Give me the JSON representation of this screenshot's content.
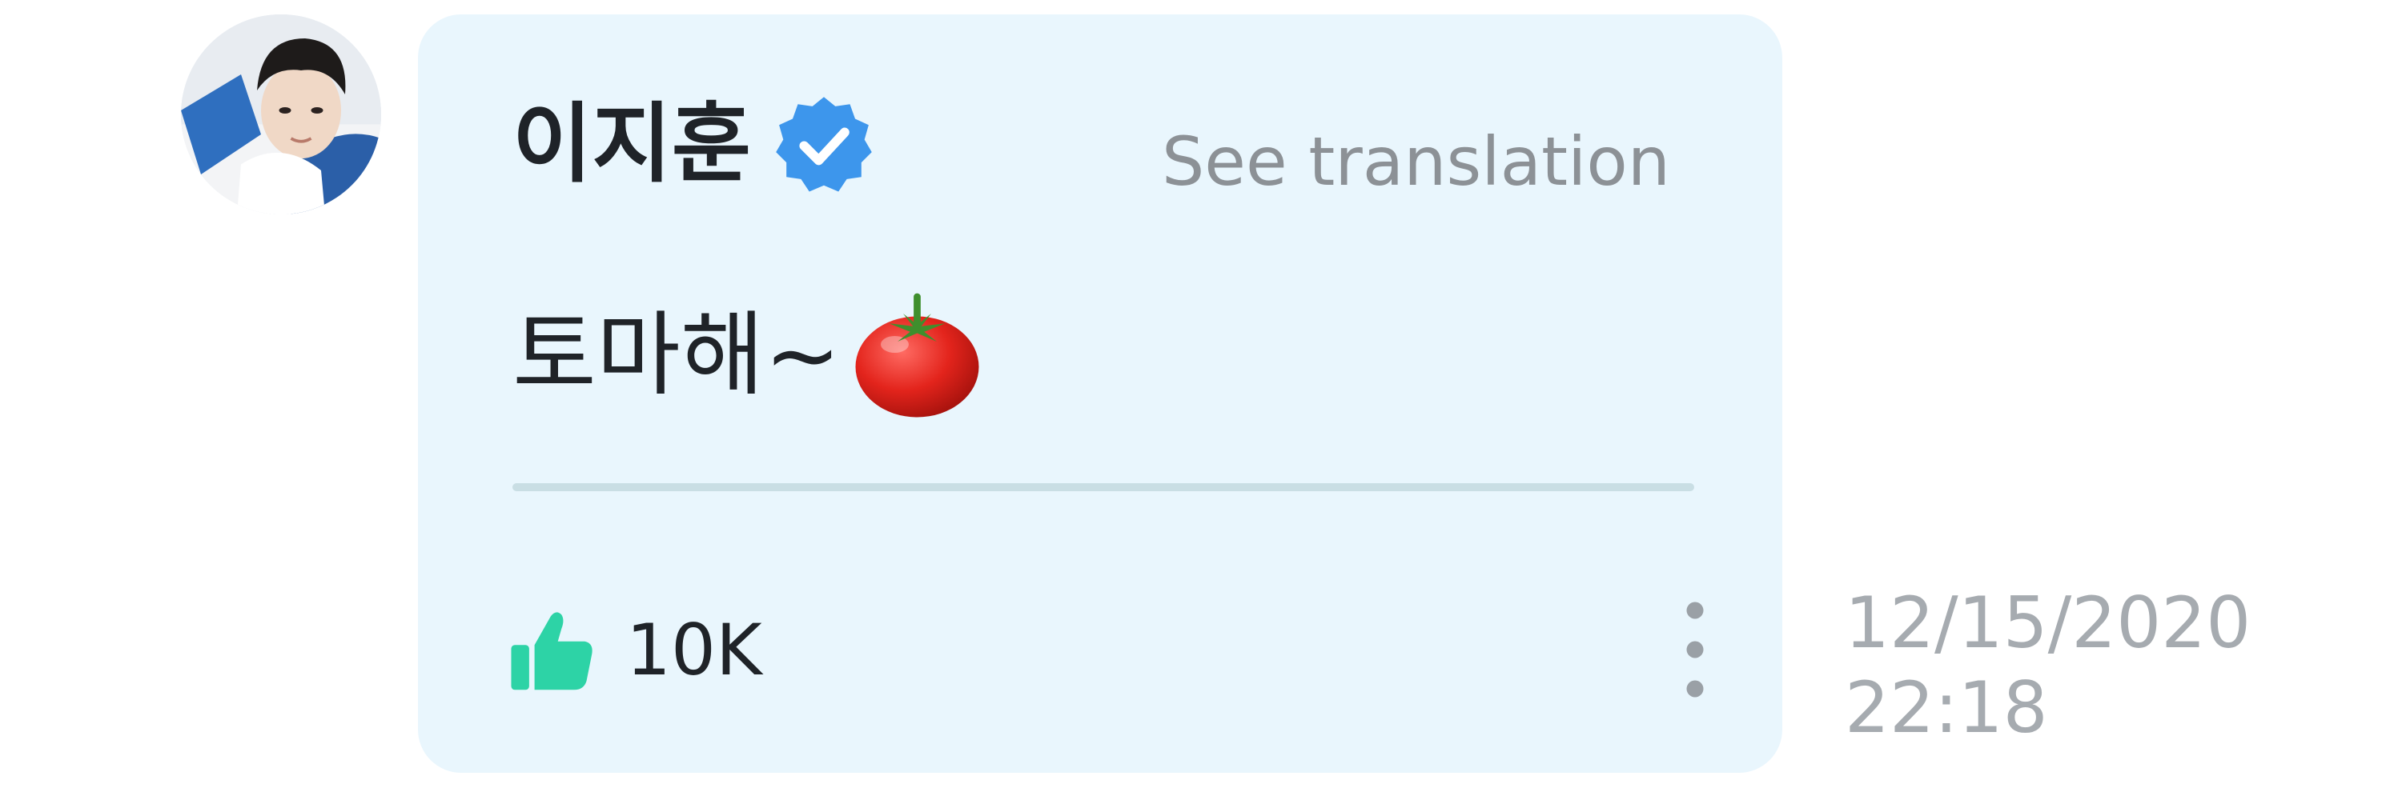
{
  "comment": {
    "author": {
      "name": "이지훈",
      "verified": true,
      "avatar_icon": "profile-photo"
    },
    "see_translation_label": "See translation",
    "message": "토마해~",
    "message_emoji": "tomato-icon",
    "likes": {
      "icon": "thumbs-up-icon",
      "count": "10K"
    },
    "more_icon": "more-vertical-icon",
    "date": "12/15/2020",
    "time": "22:18"
  },
  "colors": {
    "bubble_background": "#e9f6fd",
    "verified_badge": "#3d96ec",
    "like_icon": "#2dd3a6",
    "muted_text": "#8c9196",
    "timestamp_text": "#a6abb0",
    "primary_text": "#1f2328"
  }
}
